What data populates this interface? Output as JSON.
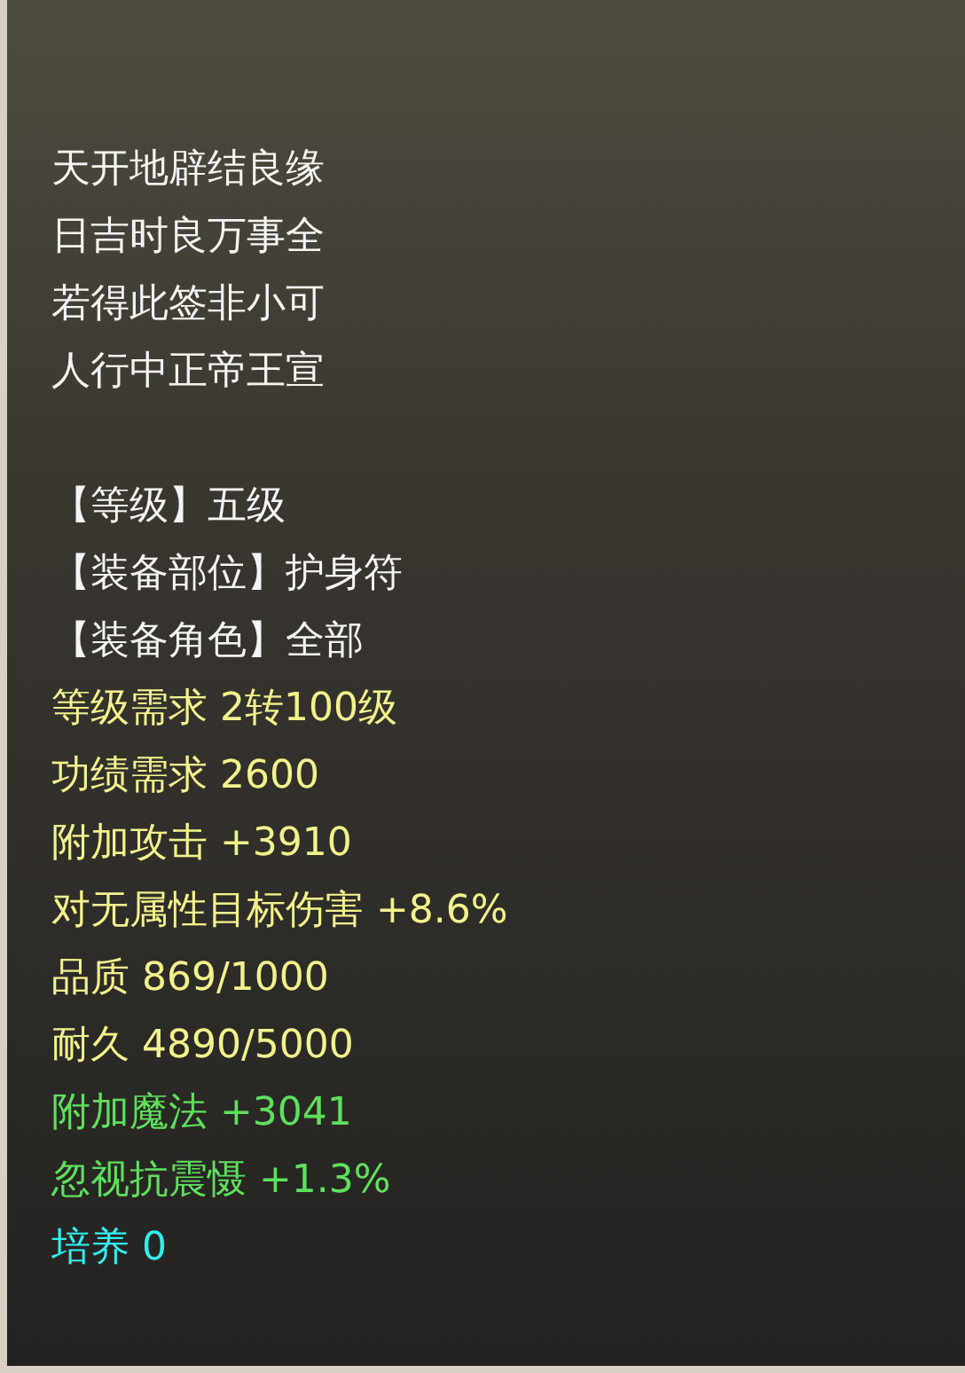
{
  "poem": [
    "天开地辟结良缘",
    "日吉时良万事全",
    "若得此签非小可",
    "人行中正帝王宣"
  ],
  "attributes": [
    {
      "kind": "base",
      "text": "【等级】五级"
    },
    {
      "kind": "base",
      "text": "【装备部位】护身符"
    },
    {
      "kind": "base",
      "text": "【装备角色】全部"
    },
    {
      "kind": "requirement",
      "text": "等级需求 2转100级"
    },
    {
      "kind": "requirement",
      "text": "功绩需求 2600"
    },
    {
      "kind": "requirement",
      "text": "附加攻击 +3910"
    },
    {
      "kind": "requirement",
      "text": "对无属性目标伤害 +8.6%"
    },
    {
      "kind": "requirement",
      "text": "品质 869/1000"
    },
    {
      "kind": "requirement",
      "text": "耐久 4890/5000"
    },
    {
      "kind": "bonus",
      "text": "附加魔法 +3041"
    },
    {
      "kind": "bonus",
      "text": "忽视抗震慑 +1.3%"
    },
    {
      "kind": "growth",
      "text": "培养 0"
    }
  ]
}
